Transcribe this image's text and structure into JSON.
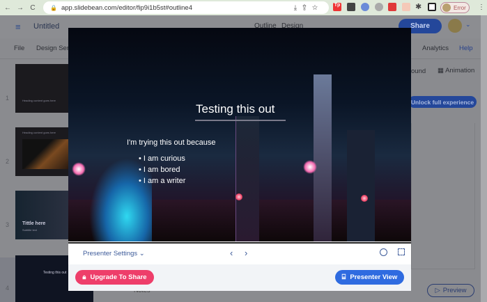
{
  "browser": {
    "url": "app.slidebean.com/editor/fip9i1b5st#outline4",
    "profile_label": "Error"
  },
  "header": {
    "title": "Untitled",
    "tabs": [
      "Outline",
      "Design"
    ],
    "share_label": "Share"
  },
  "menu": {
    "items": [
      "File",
      "Design Ser"
    ],
    "right_items": [
      "Analytics",
      "Help"
    ],
    "toolbar": [
      "ound",
      "Animation"
    ],
    "unlock_label": "Unlock full experience"
  },
  "sidebar": {
    "slides": [
      {
        "number": "1",
        "text": "Heading content goes here"
      },
      {
        "number": "2",
        "text": "Heading content goes here"
      },
      {
        "number": "3",
        "text": "Tittle here",
        "sub": "Subtitle text"
      },
      {
        "number": "4",
        "text": "Testing this out"
      }
    ]
  },
  "slide": {
    "title": "Testing this out",
    "intro": "I'm trying this out because",
    "bullets": [
      "I am curious",
      "I am bored",
      "I am a writer"
    ]
  },
  "presenter": {
    "settings_label": "Presenter Settings",
    "upgrade_label": "Upgrade To Share",
    "presenter_view_label": "Presenter View"
  },
  "bottom": {
    "notes_label": "Notes",
    "preview_label": "Preview"
  },
  "colors": {
    "accent": "#2f6be0",
    "upgrade": "#ee3e6a",
    "link": "#3c5a99"
  }
}
